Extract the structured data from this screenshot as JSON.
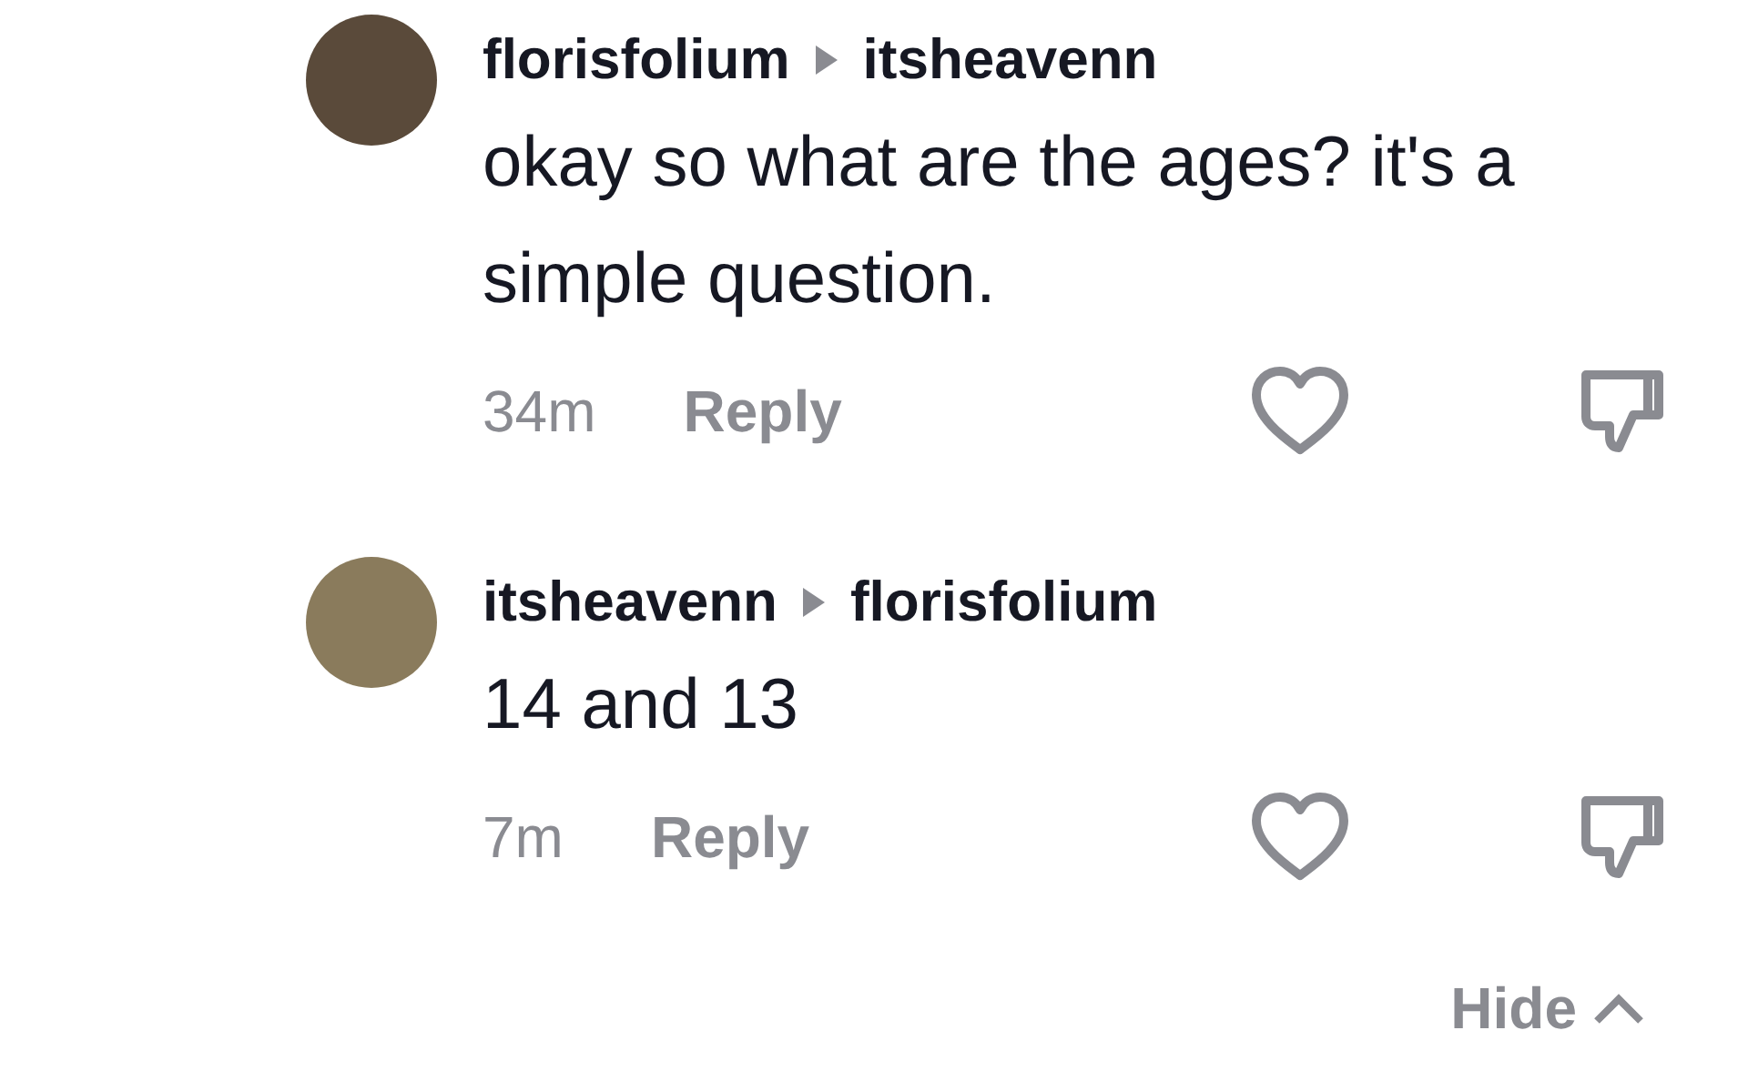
{
  "comments": [
    {
      "author": "florisfolium",
      "reply_to": "itsheavenn",
      "text": "okay so what are the ages? it's a simple question.",
      "time": "34m",
      "reply_label": "Reply",
      "liked": false,
      "disliked": false
    },
    {
      "author": "itsheavenn",
      "reply_to": "florisfolium",
      "text": "14 and 13",
      "time": "7m",
      "reply_label": "Reply",
      "liked": false,
      "disliked": false
    }
  ],
  "hide": {
    "label": "Hide"
  }
}
